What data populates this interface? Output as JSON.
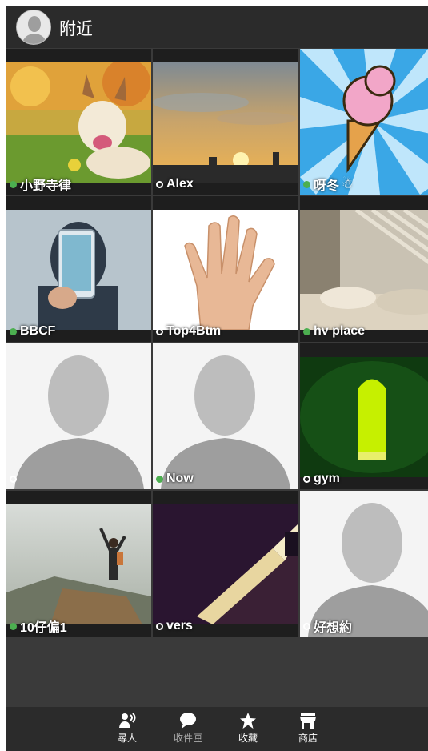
{
  "header": {
    "title": "附近"
  },
  "users": [
    {
      "name": "小野寺律",
      "online": true
    },
    {
      "name": "Alex",
      "online": false
    },
    {
      "name": "呀冬",
      "online": true
    },
    {
      "name": "BBCF",
      "online": true
    },
    {
      "name": "Top4Btm",
      "online": false
    },
    {
      "name": "hv place",
      "online": true
    },
    {
      "name": "",
      "online": false
    },
    {
      "name": "Now",
      "online": true
    },
    {
      "name": "gym",
      "online": false
    },
    {
      "name": "10仔偏1",
      "online": true
    },
    {
      "name": "vers",
      "online": false
    },
    {
      "name": "好想約",
      "online": false
    }
  ],
  "nav": {
    "items": [
      {
        "label": "尋人",
        "icon": "person-wave-icon",
        "active": true
      },
      {
        "label": "收件匣",
        "icon": "chat-bubble-icon",
        "active": false
      },
      {
        "label": "收藏",
        "icon": "star-icon",
        "active": true
      },
      {
        "label": "商店",
        "icon": "store-icon",
        "active": true
      }
    ]
  },
  "colors": {
    "online": "#4caf50",
    "header": "#2b2b2b",
    "background": "#3a3a3a"
  }
}
